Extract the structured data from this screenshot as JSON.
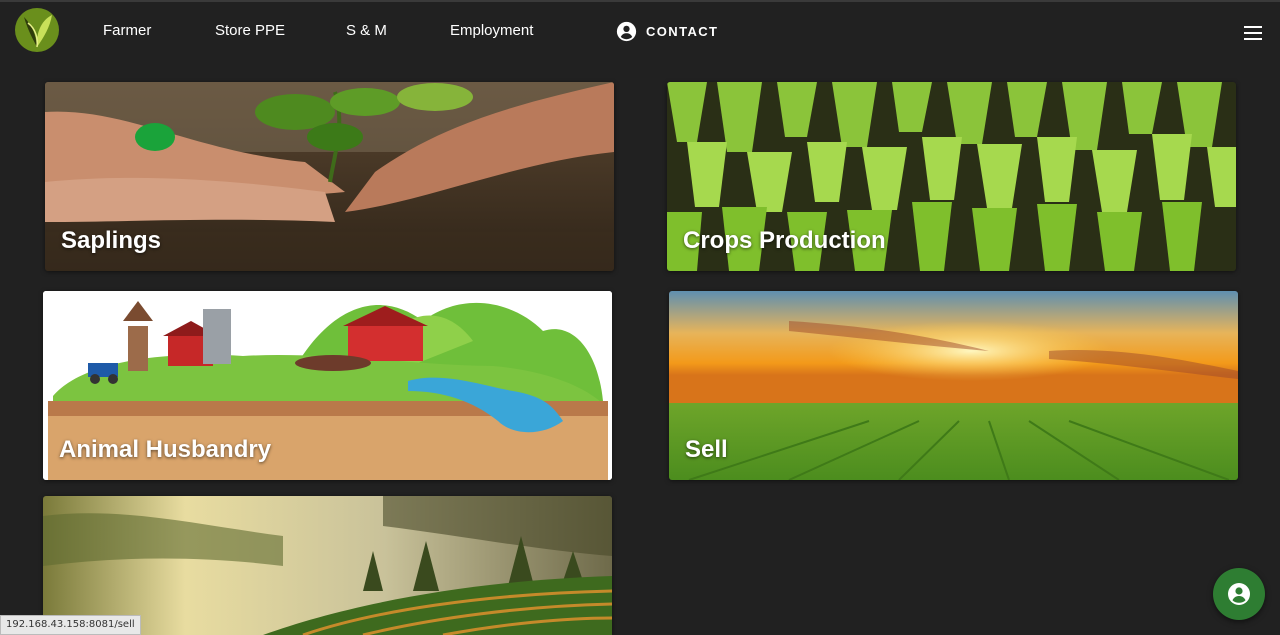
{
  "nav": {
    "links": [
      "Farmer",
      "Store PPE",
      "S & M",
      "Employment"
    ],
    "contact_label": "CONTACT",
    "logo_icon": "leaf-logo-icon",
    "contact_icon": "account-circle-icon",
    "menu_icon": "hamburger-menu-icon"
  },
  "cards": [
    {
      "title": "Saplings",
      "image": "hands-planting-seedling-photo"
    },
    {
      "title": "Crops Production",
      "image": "rice-seedling-trays-photo"
    },
    {
      "title": "Animal Husbandry",
      "image": "farm-illustration"
    },
    {
      "title": "Sell",
      "image": "sunset-field-photo"
    },
    {
      "title": "",
      "image": "misty-tea-plantation-photo"
    }
  ],
  "status_bar": {
    "url": "192.168.43.158:8081/sell"
  },
  "fab": {
    "icon": "account-circle-icon"
  },
  "colors": {
    "background": "#212121",
    "fab": "#2e7d32",
    "text": "#ffffff"
  }
}
